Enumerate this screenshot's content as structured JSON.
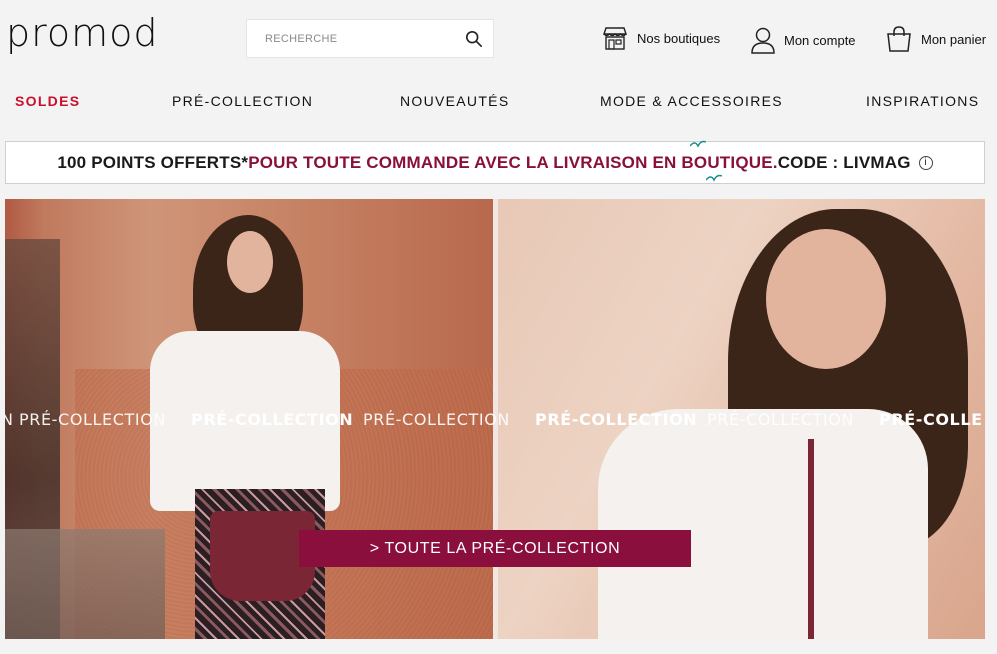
{
  "header": {
    "logo": "promod",
    "search": {
      "placeholder": "RECHERCHE"
    },
    "utilities": [
      {
        "label": "Nos boutiques",
        "icon": "store-icon"
      },
      {
        "label": "Mon compte",
        "icon": "user-icon"
      },
      {
        "label": "Mon panier",
        "icon": "bag-icon"
      }
    ]
  },
  "nav": {
    "items": [
      "SOLDES",
      "PRÉ-COLLECTION",
      "NOUVEAUTÉS",
      "MODE & ACCESSOIRES",
      "INSPIRATIONS"
    ]
  },
  "promo": {
    "part1": "100 POINTS OFFERTS* ",
    "part2": "POUR TOUTE COMMANDE AVEC LA LIVRAISON EN BOUTIQUE.",
    "part3": " CODE : LIVMAG",
    "info": "i"
  },
  "hero": {
    "strip": [
      {
        "text": "N",
        "style": "thin"
      },
      {
        "text": "PRÉ-COLLECTION",
        "style": "thin"
      },
      {
        "text": "PRÉ-COLLECTION",
        "style": "bold"
      },
      {
        "text": "PRÉ-COLLECTION",
        "style": "thin"
      },
      {
        "text": "PRÉ-COLLECTION",
        "style": "bold"
      },
      {
        "text": "PRÉ-COLLECTION",
        "style": "thin"
      },
      {
        "text": "PRÉ-COLLE",
        "style": "bold"
      }
    ],
    "cta": "> TOUTE LA PRÉ-COLLECTION"
  },
  "colors": {
    "sale": "#c8102e",
    "brand_accent": "#8a0f3c",
    "background": "#f3f3f3"
  }
}
